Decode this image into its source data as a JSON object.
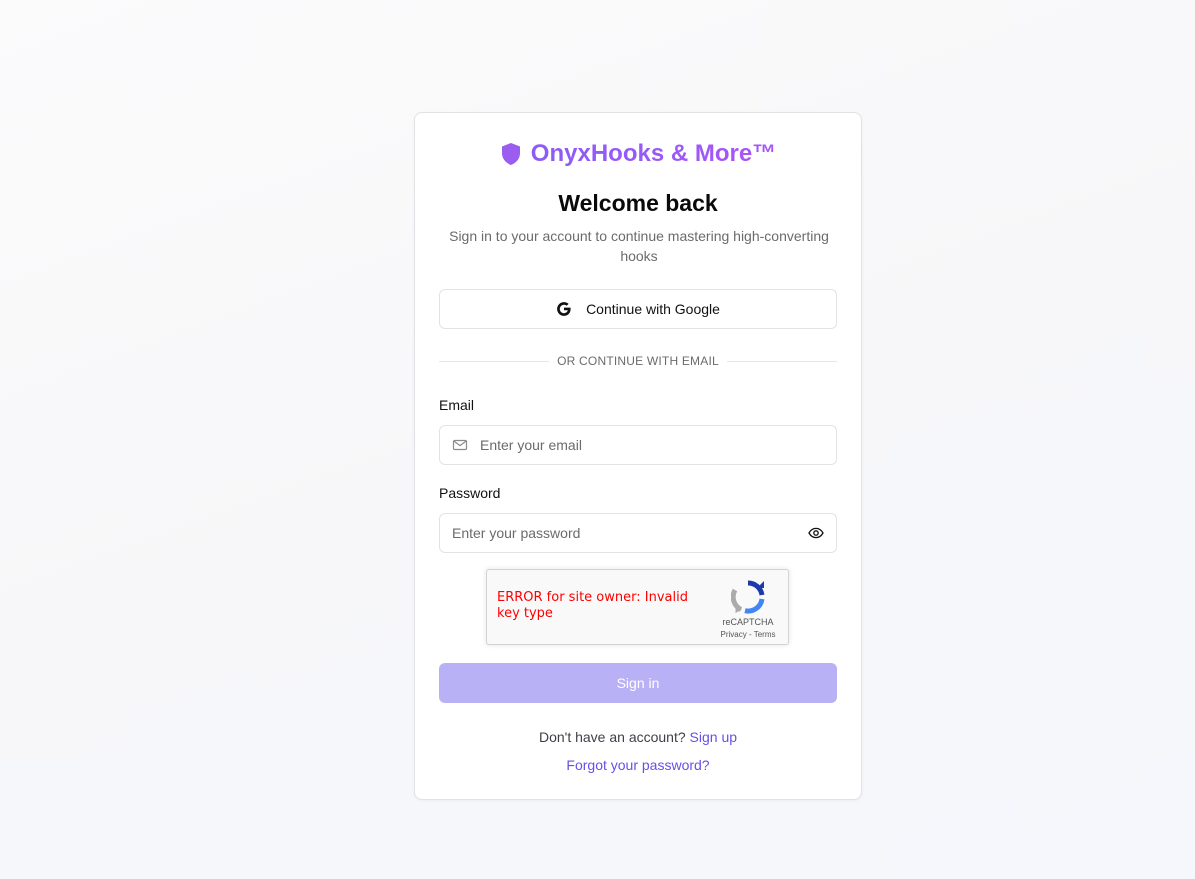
{
  "brand": {
    "name": "OnyxHooks & More™",
    "icon": "shield-icon",
    "color": "#9153ef"
  },
  "heading": {
    "title": "Welcome back",
    "subtitle": "Sign in to your account to continue mastering high-converting hooks"
  },
  "google": {
    "label": "Continue with Google",
    "icon": "google-icon"
  },
  "divider": {
    "text": "OR CONTINUE WITH EMAIL"
  },
  "email": {
    "label": "Email",
    "placeholder": "Enter your email",
    "value": "",
    "icon": "mail-icon"
  },
  "password": {
    "label": "Password",
    "placeholder": "Enter your password",
    "value": "",
    "icon": "eye-icon"
  },
  "recaptcha": {
    "error": "ERROR for site owner: Invalid key type",
    "name": "reCAPTCHA",
    "privacy": "Privacy",
    "separator": " - ",
    "terms": "Terms"
  },
  "signin": {
    "label": "Sign in",
    "color": "#b9b1f6"
  },
  "footer": {
    "signup_prompt": "Don't have an account?",
    "signup_link": "Sign up",
    "forgot_link": "Forgot your password?",
    "link_color": "#6a4ee6"
  }
}
